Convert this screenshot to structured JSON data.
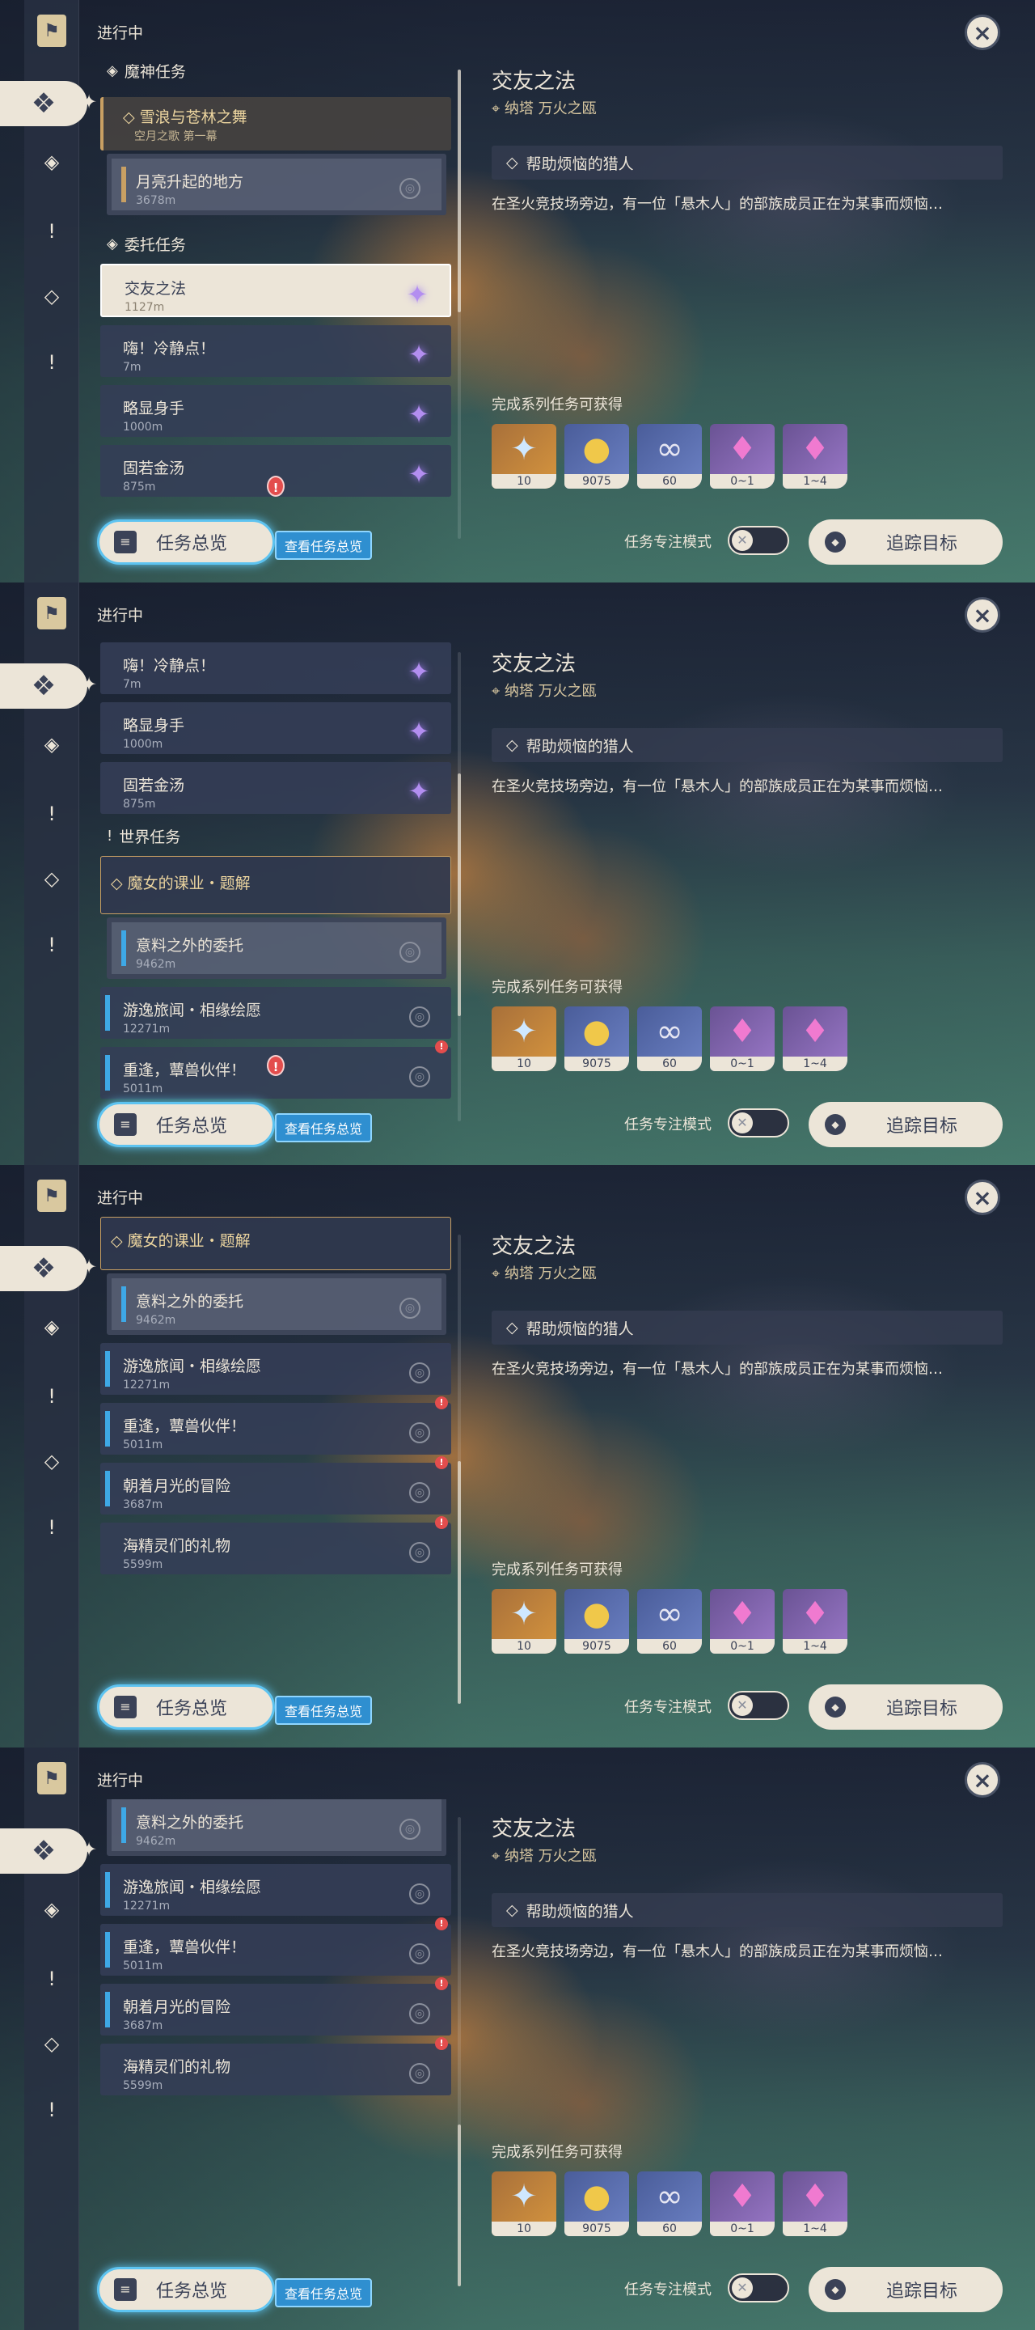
{
  "header": {
    "label": "进行中",
    "close_icon": "×"
  },
  "bottom": {
    "overview_label": "任务总览",
    "overview_tip": "查看任务总览",
    "focus_mode_label": "任务专注模式",
    "track_label": "追踪目标"
  },
  "detail": {
    "title": "交友之法",
    "location": "纳塔 万火之瓯",
    "step": "帮助烦恼的猎人",
    "description": "在圣火竞技场旁边，有一位「悬木人」的部族成员正在为某事而烦恼…",
    "reward_label": "完成系列任务可获得",
    "rewards": [
      {
        "icon": "primogem-icon",
        "amount": "10"
      },
      {
        "icon": "mora-icon",
        "amount": "9075"
      },
      {
        "icon": "adventure-exp-icon",
        "amount": "60"
      },
      {
        "icon": "crystal-chunk-icon",
        "amount": "0~1"
      },
      {
        "icon": "crystal-cluster-icon",
        "amount": "1~4"
      }
    ]
  },
  "sections": {
    "archon": "魔神任务",
    "commission": "委托任务",
    "world": "世界任务"
  },
  "quests": {
    "archon_main": {
      "title": "雪浪与苍林之舞",
      "sub": "空月之歌 第一幕"
    },
    "archon_sub": {
      "title": "月亮升起的地方",
      "dist": "3678m"
    },
    "c1": {
      "title": "交友之法",
      "dist": "1127m"
    },
    "c2": {
      "title": "嗨！冷静点！",
      "dist": "7m"
    },
    "c3": {
      "title": "略显身手",
      "dist": "1000m"
    },
    "c4": {
      "title": "固若金汤",
      "dist": "875m"
    },
    "world_main": {
      "title": "魔女的课业・题解"
    },
    "w_sub": {
      "title": "意料之外的委托",
      "dist": "9462m"
    },
    "w2": {
      "title": "游逸旅闻・相缘绘愿",
      "dist": "12271m"
    },
    "w3": {
      "title": "重逢，蕈兽伙伴！",
      "dist": "5011m"
    },
    "w4": {
      "title": "朝着月光的冒险",
      "dist": "3687m"
    },
    "w5": {
      "title": "海精灵们的礼物",
      "dist": "5599m"
    }
  }
}
